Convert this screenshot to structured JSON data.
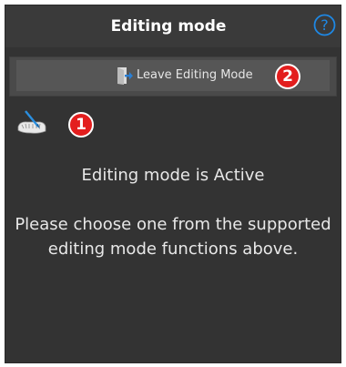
{
  "header": {
    "title": "Editing mode",
    "help_icon": "help-circle-icon"
  },
  "toolbar": {
    "leave_label": "Leave Editing Mode",
    "leave_icon": "exit-door-icon"
  },
  "tools": {
    "items": [
      {
        "icon": "jaw-edit-tool-icon"
      }
    ]
  },
  "annotations": {
    "badge_1": "1",
    "badge_2": "2"
  },
  "message": {
    "title": "Editing mode is Active",
    "body": "Please choose one from the supported editing mode functions above."
  },
  "colors": {
    "panel_bg": "#333333",
    "header_bg": "#3a3a3a",
    "button_bg": "#565656",
    "help_blue": "#1e88e5",
    "badge_red": "#e31e1e",
    "text": "#e8e8e8"
  }
}
